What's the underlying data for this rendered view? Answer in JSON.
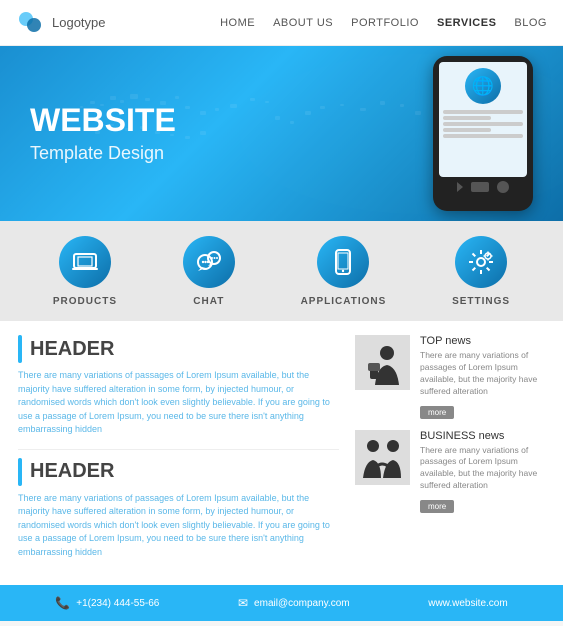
{
  "nav": {
    "logo_text": "Logotype",
    "links": [
      "HOME",
      "ABOUT US",
      "PORTFOLIO",
      "SERVICES",
      "BLOG"
    ]
  },
  "hero": {
    "title": "WEBSITE",
    "subtitle": "Template Design"
  },
  "features": [
    {
      "id": "products",
      "label": "PRODUCTS",
      "icon": "laptop"
    },
    {
      "id": "chat",
      "label": "CHAT",
      "icon": "chat"
    },
    {
      "id": "applications",
      "label": "APPLICATIONS",
      "icon": "phone"
    },
    {
      "id": "settings",
      "label": "SETTINGS",
      "icon": "gear"
    }
  ],
  "sections": [
    {
      "title": "HEADER",
      "body": "There are many variations of passages of Lorem Ipsum available, but the majority have suffered alteration in some form, by injected humour, or randomised words which don't look even slightly believable. If you are going to use a passage of Lorem Ipsum, you need to be sure there isn't anything embarrassing hidden"
    },
    {
      "title": "HEADER",
      "body": "There are many variations of passages of Lorem Ipsum available, but the majority have suffered alteration in some form, by injected humour, or randomised words which don't look even slightly believable. If you are going to use a passage of Lorem Ipsum, you need to be sure there isn't anything embarrassing hidden"
    }
  ],
  "news": [
    {
      "title": "TOP news",
      "body": "There are many variations of passages of Lorem Ipsum available, but the majority have suffered alteration",
      "more": "more"
    },
    {
      "title": "BUSINESS news",
      "body": "There are many variations of passages of Lorem Ipsum available, but the majority have suffered alteration",
      "more": "more"
    }
  ],
  "footer": {
    "phone": "+1(234) 444-55-66",
    "email": "email@company.com",
    "website": "www.website.com"
  }
}
